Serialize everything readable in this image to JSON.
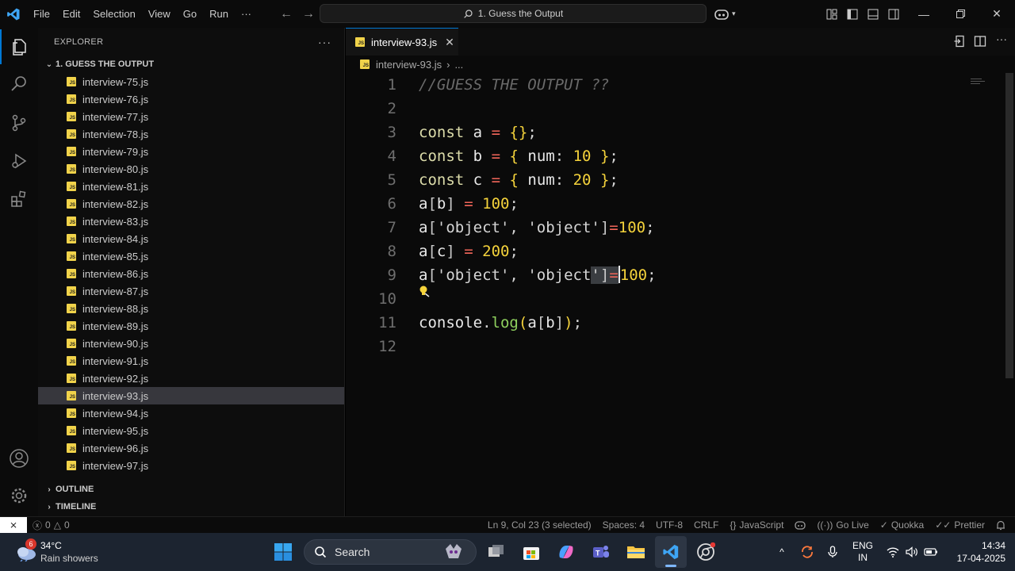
{
  "menu": {
    "file": "File",
    "edit": "Edit",
    "selection": "Selection",
    "view": "View",
    "go": "Go",
    "run": "Run",
    "more": "···"
  },
  "command_center": {
    "text": "1. Guess the Output"
  },
  "explorer": {
    "title": "EXPLORER",
    "folder": "1. GUESS THE OUTPUT",
    "files": [
      "interview-75.js",
      "interview-76.js",
      "interview-77.js",
      "interview-78.js",
      "interview-79.js",
      "interview-80.js",
      "interview-81.js",
      "interview-82.js",
      "interview-83.js",
      "interview-84.js",
      "interview-85.js",
      "interview-86.js",
      "interview-87.js",
      "interview-88.js",
      "interview-89.js",
      "interview-90.js",
      "interview-91.js",
      "interview-92.js",
      "interview-93.js",
      "interview-94.js",
      "interview-95.js",
      "interview-96.js",
      "interview-97.js"
    ],
    "selected_file": "interview-93.js",
    "outline": "OUTLINE",
    "timeline": "TIMELINE"
  },
  "editor": {
    "tab": "interview-93.js",
    "breadcrumb_file": "interview-93.js",
    "breadcrumb_sep": "›",
    "breadcrumb_more": "...",
    "line_numbers": [
      "1",
      "2",
      "3",
      "4",
      "5",
      "6",
      "7",
      "8",
      "9",
      "10",
      "11",
      "12"
    ]
  },
  "statusbar": {
    "errors": "0",
    "warnings": "0",
    "position": "Ln 9, Col 23 (3 selected)",
    "spaces": "Spaces: 4",
    "encoding": "UTF-8",
    "eol": "CRLF",
    "language": "JavaScript",
    "golive": "Go Live",
    "quokka": "Quokka",
    "prettier": "Prettier"
  },
  "taskbar": {
    "weather_temp": "34°C",
    "weather_desc": "Rain showers",
    "weather_badge": "6",
    "search": "Search",
    "lang1": "ENG",
    "lang2": "IN",
    "time": "14:34",
    "date": "17-04-2025"
  },
  "colors": {
    "accent": "#0078d4",
    "js_icon": "#f1d34a",
    "titlebar": "#0b0b0b",
    "taskbar": "#1c2430"
  }
}
